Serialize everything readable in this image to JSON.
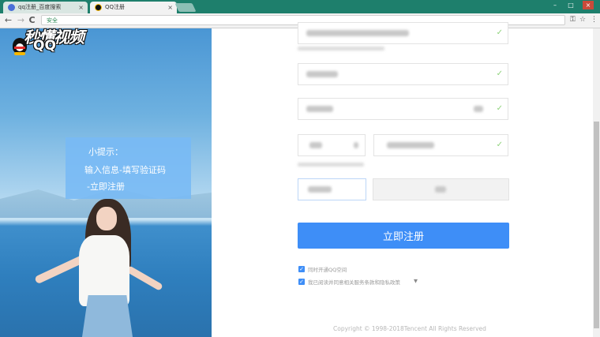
{
  "browser": {
    "tabs": [
      {
        "title": "qq注册_百度搜索",
        "active": false,
        "icon": "baidu-icon"
      },
      {
        "title": "QQ注册",
        "active": true,
        "icon": "qq-icon"
      }
    ],
    "close_glyph": "×",
    "window_controls": {
      "minimize": "–",
      "maximize": "□",
      "close": "×"
    },
    "nav": {
      "back": "←",
      "forward": "→",
      "reload": "C"
    },
    "security_label": "安全",
    "key_icon_glyph": "⚿",
    "star_icon_glyph": "☆",
    "menu_icon_glyph": "⋮"
  },
  "watermark": {
    "brand": "秒懂视频"
  },
  "qq_logo": {
    "text": "QQ"
  },
  "tip": {
    "title": "小提示：",
    "line1": "输入信息-填写验证码",
    "line2": "-立即注册"
  },
  "form": {
    "check_glyph": "✓",
    "register_button": "立即注册",
    "checkbox1_label": "同时开通QQ空间",
    "checkbox2_label": "我已阅读并同意相关服务条款和隐私政策",
    "dropdown_glyph": "▼",
    "checkbox_glyph": "✓"
  },
  "footer": {
    "copyright": "Copyright © 1998-2018Tencent All Rights Reserved"
  },
  "colors": {
    "accent": "#3e8ef7",
    "tab_strip": "#1e7f6c",
    "tip_bg": "#78b9f5"
  }
}
